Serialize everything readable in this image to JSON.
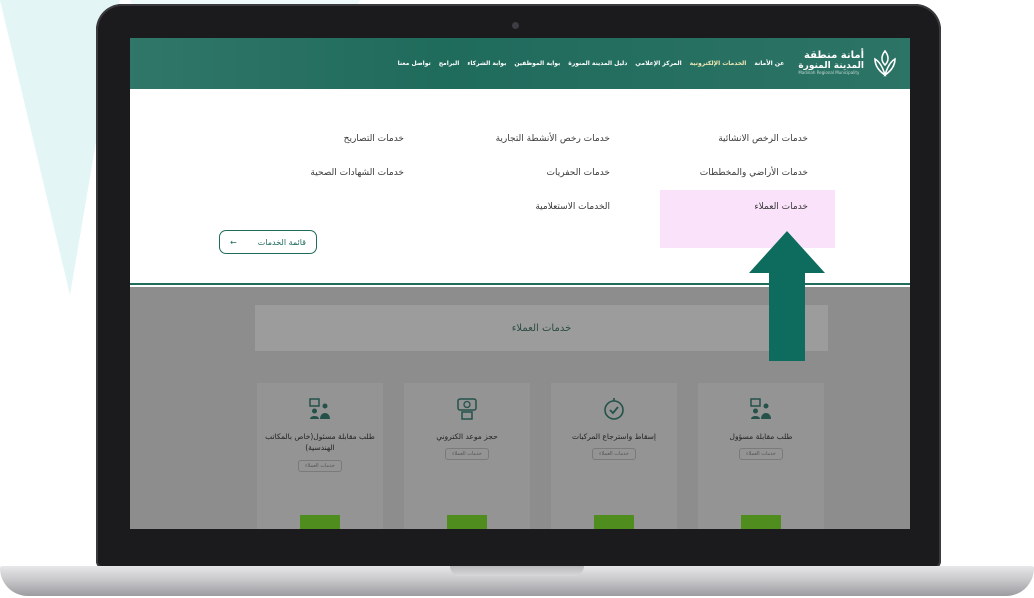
{
  "header": {
    "logo": {
      "line1": "أمانة منطقة",
      "line2": "المدينة المنورة",
      "line3": "Madinah Regional Municipality"
    },
    "nav": [
      {
        "label": "عن الأمانة"
      },
      {
        "label": "الخدمات الإلكترونية"
      },
      {
        "label": "المركز الإعلامي"
      },
      {
        "label": "دليل المدينة المنورة"
      },
      {
        "label": "بوابة الموظفين"
      },
      {
        "label": "بوابة الشركاء"
      },
      {
        "label": "البرامج"
      },
      {
        "label": "تواصل معنا"
      }
    ]
  },
  "mega_menu": {
    "links": [
      "خدمات الرخص الانشائية",
      "خدمات رخص الأنشطة التجارية",
      "خدمات التصاريح",
      "خدمات الأراضي والمخططات",
      "خدمات الحفريات",
      "خدمات الشهادات الصحية",
      "خدمات العملاء",
      "الخدمات الاستعلامية"
    ],
    "services_list_button": "قائمة الخدمات"
  },
  "section": {
    "title": "خدمات العملاء",
    "cards": [
      {
        "title": "طلب مقابلة مسؤول",
        "tag": "خدمات العملاء",
        "icon": "meeting-icon"
      },
      {
        "title": "إسقاط واسترجاع المركبات",
        "tag": "خدمات العملاء",
        "icon": "check-circle-icon"
      },
      {
        "title": "حجز موعد الكتروني",
        "tag": "خدمات العملاء",
        "icon": "appointment-icon"
      },
      {
        "title": "طلب مقابلة مسئول(خاص بالمكاتب الهندسية)",
        "tag": "خدمات العملاء",
        "icon": "meeting-icon"
      }
    ]
  },
  "colors": {
    "brand": "#1f6b5c",
    "highlight": "#fbe2fb",
    "card_button": "#4e8d1e"
  }
}
